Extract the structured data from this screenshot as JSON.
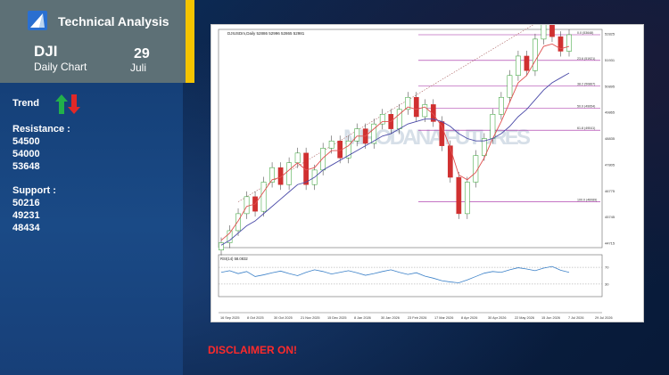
{
  "header": {
    "title": "Technical Analysis",
    "symbol": "DJI",
    "chart_kind": "Daily Chart",
    "day": "29",
    "month": "Juli",
    "logo_icon": "arrow-logo-icon"
  },
  "sidebar": {
    "trend_label": "Trend",
    "trend_icon": "up-down-arrows-icon",
    "resistance_label": "Resistance :",
    "resistance": [
      "54500",
      "54000",
      "53648"
    ],
    "support_label": "Support :",
    "support": [
      "50216",
      "49231",
      "48434"
    ]
  },
  "disclaimer": "DISCLAIMER ON!",
  "colors": {
    "accent": "#f5c400",
    "header_box": "#5d7076",
    "disclaimer": "#ff2a2a",
    "candle_up": "#2a9d2a",
    "candle_down": "#d03030",
    "ma_fast": "#e05050",
    "ma_slow": "#4a4aa8",
    "fib_line": "#a020a0",
    "rsi_line": "#3a80c8"
  },
  "chart_data": [
    {
      "type": "candlestick",
      "title": "DJIUSDm,Daily  52886 52996 52865 52981",
      "watermark": "MIRODANA FUTURES",
      "y_ticks": [
        "52825",
        "51931",
        "50895",
        "49865",
        "48835",
        "47805",
        "46775",
        "45745",
        "44715"
      ],
      "ylim": [
        44200,
        53200
      ],
      "x_ticks": [
        "16 Sep 2025",
        "8 Oct 2025",
        "30 Oct 2025",
        "21 Nov 2025",
        "15 Dec 2025",
        "8 Jan 2026",
        "30 Jan 2026",
        "23 Feb 2026",
        "17 Mar 2026",
        "8 Apr 2026",
        "30 Apr 2026",
        "22 May 2026",
        "15 Jun 2026",
        "7 Jul 2026",
        "29 Jul 2026"
      ],
      "last_price": "52981",
      "fibonacci": [
        {
          "label": "0.0 (53648)",
          "value": 53648
        },
        {
          "label": "23.6 (51921)",
          "value": 51921
        },
        {
          "label": "38.2 (50867)",
          "value": 50867
        },
        {
          "label": "50.0 (49954)",
          "value": 49954
        },
        {
          "label": "61.8 (49041)",
          "value": 49041
        },
        {
          "label": "100.0 (46089)",
          "value": 46089
        }
      ],
      "close": [
        44400,
        44900,
        45600,
        46300,
        45700,
        46900,
        47500,
        46800,
        47700,
        48100,
        46800,
        47400,
        48300,
        48600,
        47900,
        48600,
        49100,
        48500,
        49300,
        49700,
        49100,
        49900,
        50400,
        49600,
        50100,
        49400,
        48400,
        47100,
        45600,
        46900,
        48000,
        48700,
        49700,
        50400,
        51300,
        52100,
        51500,
        52800,
        53400,
        52900,
        52300,
        52981
      ],
      "series": [
        {
          "name": "MA fast",
          "values": [
            44500,
            44800,
            45300,
            45900,
            46000,
            46500,
            47000,
            47100,
            47400,
            47700,
            47400,
            47500,
            47900,
            48200,
            48200,
            48400,
            48800,
            48800,
            49100,
            49400,
            49400,
            49700,
            50000,
            49900,
            50000,
            49700,
            49200,
            48300,
            47200,
            47000,
            47300,
            47900,
            48700,
            49400,
            50200,
            51000,
            51300,
            51900,
            52500,
            52600,
            52400,
            52500
          ]
        },
        {
          "name": "MA slow",
          "values": [
            44300,
            44500,
            44800,
            45100,
            45300,
            45600,
            45900,
            46200,
            46500,
            46800,
            46900,
            47100,
            47400,
            47600,
            47800,
            48000,
            48200,
            48400,
            48600,
            48800,
            48900,
            49100,
            49300,
            49400,
            49500,
            49500,
            49400,
            49200,
            48900,
            48700,
            48600,
            48600,
            48700,
            48900,
            49200,
            49600,
            49900,
            50300,
            50700,
            51000,
            51200,
            51400
          ]
        }
      ]
    },
    {
      "type": "line",
      "title": "RSI(14) 58.0832",
      "ylim": [
        0,
        100
      ],
      "levels": [
        70,
        30
      ],
      "series": [
        {
          "name": "RSI(14)",
          "values": [
            58,
            62,
            55,
            60,
            48,
            52,
            57,
            61,
            55,
            50,
            58,
            64,
            60,
            54,
            58,
            62,
            57,
            51,
            55,
            60,
            64,
            58,
            53,
            57,
            49,
            44,
            38,
            35,
            33,
            40,
            48,
            56,
            60,
            58,
            64,
            69,
            66,
            62,
            68,
            72,
            63,
            58
          ]
        }
      ]
    }
  ]
}
